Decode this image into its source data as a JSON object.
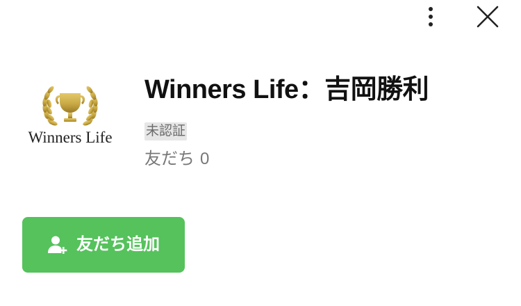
{
  "header": {
    "more_icon": "more-vertical-icon",
    "close_icon": "close-icon"
  },
  "profile": {
    "logo_text": "Winners Life",
    "logo_icon": "trophy-laurel-icon",
    "name": "Winners Life：吉岡勝利",
    "verification_badge": "未認証",
    "friends_label": "友だち",
    "friends_count": "0"
  },
  "actions": {
    "add_friend_label": "友だち追加",
    "add_friend_icon": "add-user-icon"
  },
  "colors": {
    "accent_green": "#55c25c",
    "badge_bg": "#e6e6e6",
    "logo_gold": "#c9a944"
  }
}
